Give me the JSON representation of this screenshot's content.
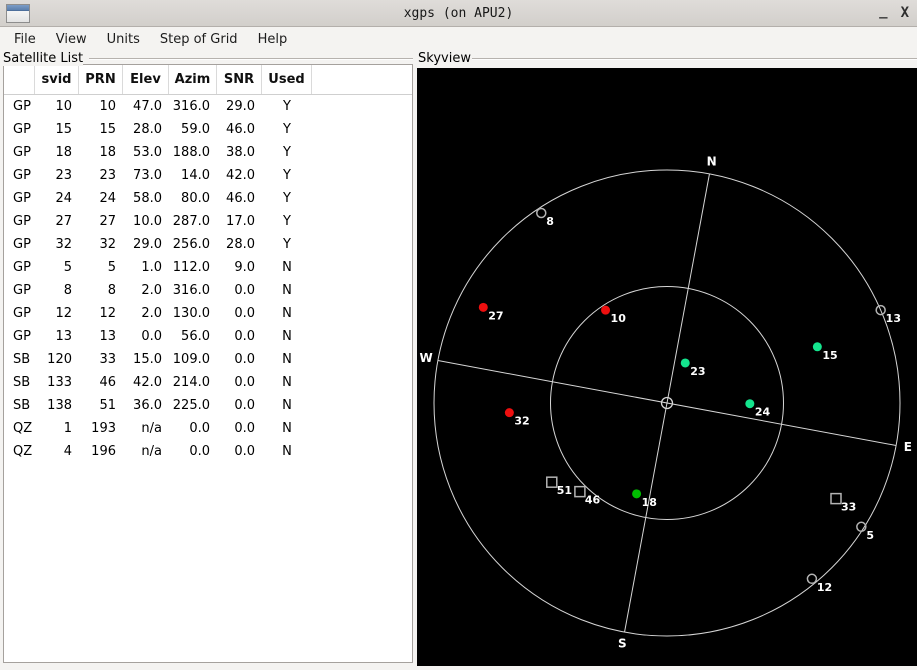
{
  "window": {
    "title": "xgps (on APU2)",
    "minimize": "_",
    "close": "X"
  },
  "menu": {
    "items": [
      "File",
      "View",
      "Units",
      "Step of Grid",
      "Help"
    ]
  },
  "satellite_list": {
    "frame_label": "Satellite List",
    "columns": [
      "",
      "svid",
      "PRN",
      "Elev",
      "Azim",
      "SNR",
      "Used"
    ],
    "rows": [
      {
        "type": "GP",
        "svid": "10",
        "prn": "10",
        "elev": "47.0",
        "azim": "316.0",
        "snr": "29.0",
        "used": "Y"
      },
      {
        "type": "GP",
        "svid": "15",
        "prn": "15",
        "elev": "28.0",
        "azim": "59.0",
        "snr": "46.0",
        "used": "Y"
      },
      {
        "type": "GP",
        "svid": "18",
        "prn": "18",
        "elev": "53.0",
        "azim": "188.0",
        "snr": "38.0",
        "used": "Y"
      },
      {
        "type": "GP",
        "svid": "23",
        "prn": "23",
        "elev": "73.0",
        "azim": "14.0",
        "snr": "42.0",
        "used": "Y"
      },
      {
        "type": "GP",
        "svid": "24",
        "prn": "24",
        "elev": "58.0",
        "azim": "80.0",
        "snr": "46.0",
        "used": "Y"
      },
      {
        "type": "GP",
        "svid": "27",
        "prn": "27",
        "elev": "10.0",
        "azim": "287.0",
        "snr": "17.0",
        "used": "Y"
      },
      {
        "type": "GP",
        "svid": "32",
        "prn": "32",
        "elev": "29.0",
        "azim": "256.0",
        "snr": "28.0",
        "used": "Y"
      },
      {
        "type": "GP",
        "svid": "5",
        "prn": "5",
        "elev": "1.0",
        "azim": "112.0",
        "snr": "9.0",
        "used": "N"
      },
      {
        "type": "GP",
        "svid": "8",
        "prn": "8",
        "elev": "2.0",
        "azim": "316.0",
        "snr": "0.0",
        "used": "N"
      },
      {
        "type": "GP",
        "svid": "12",
        "prn": "12",
        "elev": "2.0",
        "azim": "130.0",
        "snr": "0.0",
        "used": "N"
      },
      {
        "type": "GP",
        "svid": "13",
        "prn": "13",
        "elev": "0.0",
        "azim": "56.0",
        "snr": "0.0",
        "used": "N"
      },
      {
        "type": "SB",
        "svid": "120",
        "prn": "33",
        "elev": "15.0",
        "azim": "109.0",
        "snr": "0.0",
        "used": "N"
      },
      {
        "type": "SB",
        "svid": "133",
        "prn": "46",
        "elev": "42.0",
        "azim": "214.0",
        "snr": "0.0",
        "used": "N"
      },
      {
        "type": "SB",
        "svid": "138",
        "prn": "51",
        "elev": "36.0",
        "azim": "225.0",
        "snr": "0.0",
        "used": "N"
      },
      {
        "type": "QZ",
        "svid": "1",
        "prn": "193",
        "elev": "n/a",
        "azim": "0.0",
        "snr": "0.0",
        "used": "N"
      },
      {
        "type": "QZ",
        "svid": "4",
        "prn": "196",
        "elev": "n/a",
        "azim": "0.0",
        "snr": "0.0",
        "used": "N"
      }
    ]
  },
  "skyview": {
    "frame_label": "Skyview",
    "rotation_deg": 10.5,
    "grid_elevations": [
      0,
      45
    ],
    "compass": {
      "north": "N",
      "east": "E",
      "south": "S",
      "west": "W"
    },
    "colors": {
      "background": "#000000",
      "grid": "#d6d6d6",
      "label": "#ffffff",
      "snr_high": "#14e58e",
      "snr_mid": "#00bd00",
      "snr_low": "#ee0f0f",
      "unused": "#b4b4b4"
    }
  }
}
